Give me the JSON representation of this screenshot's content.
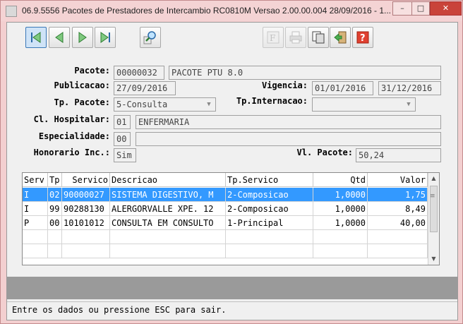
{
  "window": {
    "title": "06.9.5556  Pacotes de Prestadores de Intercambio RC0810M Versao 2.00.00.004 28/09/2016 - 1...",
    "minimize_icon": "minimize-icon",
    "maximize_icon": "maximize-icon",
    "close_icon": "close-icon"
  },
  "toolbar": {
    "buttons": [
      {
        "icon": "first-record-icon"
      },
      {
        "icon": "previous-record-icon"
      },
      {
        "icon": "next-record-icon"
      },
      {
        "icon": "last-record-icon"
      },
      {
        "icon": "search-zoom-icon"
      },
      {
        "icon": "filter-icon"
      },
      {
        "icon": "print-icon"
      },
      {
        "icon": "copy-icon"
      },
      {
        "icon": "exit-icon"
      },
      {
        "icon": "help-icon"
      }
    ]
  },
  "form": {
    "pacote": {
      "label": "Pacote:",
      "code": "00000032",
      "desc": "PACOTE PTU 8.0"
    },
    "publicacao": {
      "label": "Publicacao:",
      "value": "27/09/2016"
    },
    "vigencia": {
      "label": "Vigencia:",
      "from": "01/01/2016",
      "to": "31/12/2016"
    },
    "tp_pacote": {
      "label": "Tp. Pacote:",
      "value": "5-Consulta"
    },
    "tp_internacao": {
      "label": "Tp.Internacao:",
      "value": ""
    },
    "cl_hospitalar": {
      "label": "Cl. Hospitalar:",
      "code": "01",
      "desc": "ENFERMARIA"
    },
    "especialidade": {
      "label": "Especialidade:",
      "code": "00",
      "desc": ""
    },
    "honorario": {
      "label": "Honorario Inc.:",
      "value": "Sim"
    },
    "vl_pacote": {
      "label": "Vl. Pacote:",
      "value": "50,24"
    }
  },
  "grid": {
    "columns": [
      "Serv",
      "Tp",
      "Servico",
      "Descricao",
      "Tp.Servico",
      "Qtd",
      "Valor"
    ],
    "rows": [
      {
        "serv": "I",
        "tp": "02",
        "servico": "90000027",
        "descricao": "SISTEMA DIGESTIVO, M",
        "tp_servico": "2-Composicao",
        "qtd": "1,0000",
        "valor": "1,75",
        "selected": true
      },
      {
        "serv": "I",
        "tp": "99",
        "servico": "90288130",
        "descricao": "ALERGORVALLE XPE. 12",
        "tp_servico": "2-Composicao",
        "qtd": "1,0000",
        "valor": "8,49",
        "selected": false
      },
      {
        "serv": "P",
        "tp": "00",
        "servico": "10101012",
        "descricao": "CONSULTA EM CONSULTO",
        "tp_servico": "1-Principal",
        "qtd": "1,0000",
        "valor": "40,00",
        "selected": false
      }
    ]
  },
  "status": {
    "message": "Entre os dados ou pressione ESC para sair."
  },
  "colors": {
    "window_frame": "#f3cfd0",
    "selection": "#3399ff",
    "close_button": "#c9433a"
  }
}
